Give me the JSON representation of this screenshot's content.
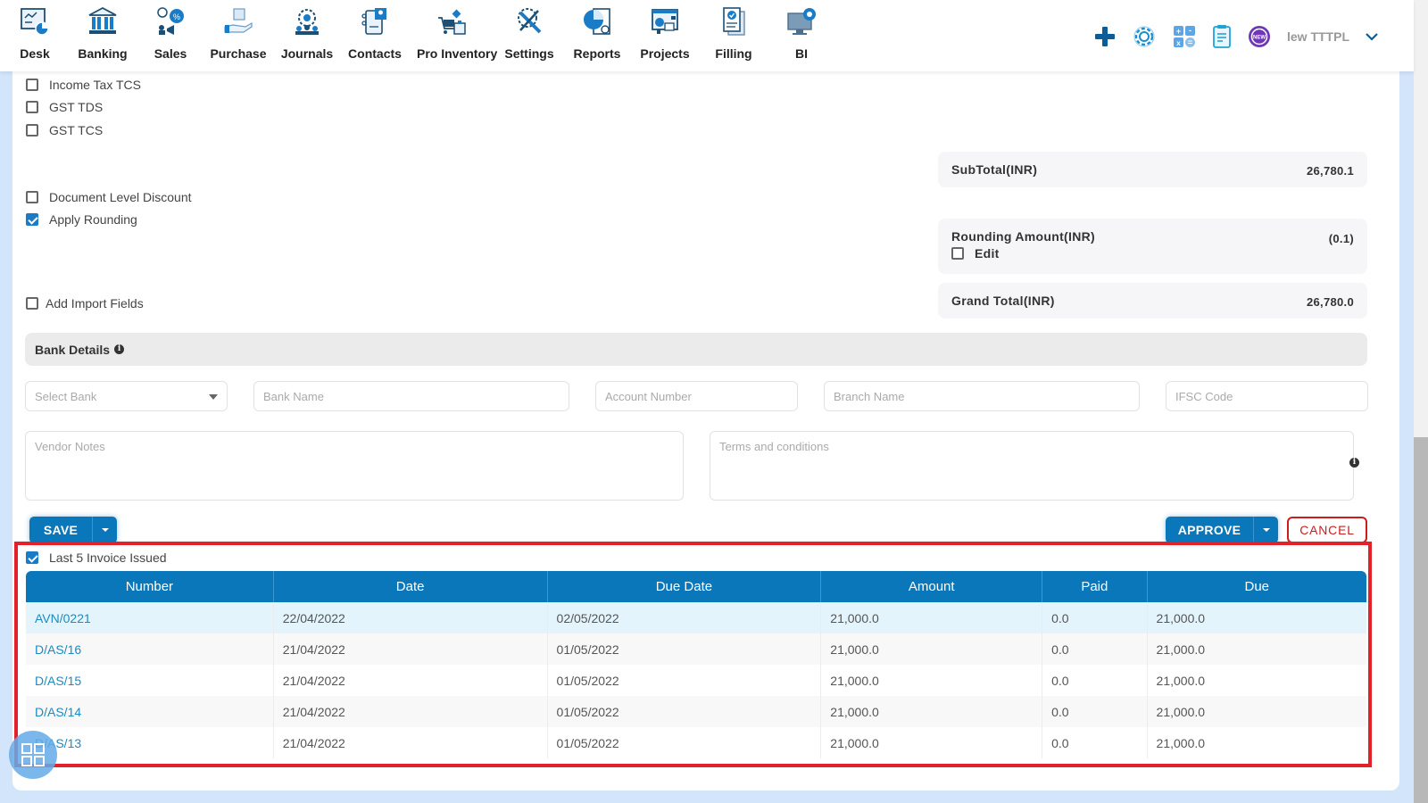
{
  "nav": {
    "items": [
      {
        "label": "Desk",
        "icon": "desk-icon"
      },
      {
        "label": "Banking",
        "icon": "bank-icon"
      },
      {
        "label": "Sales",
        "icon": "sales-icon"
      },
      {
        "label": "Purchase",
        "icon": "purchase-icon"
      },
      {
        "label": "Journals",
        "icon": "journals-icon"
      },
      {
        "label": "Contacts",
        "icon": "contacts-icon"
      },
      {
        "label": "Pro Inventory",
        "icon": "inventory-icon"
      },
      {
        "label": "Settings",
        "icon": "settings-tools-icon"
      },
      {
        "label": "Reports",
        "icon": "reports-icon"
      },
      {
        "label": "Projects",
        "icon": "projects-icon"
      },
      {
        "label": "Filling",
        "icon": "filling-icon"
      },
      {
        "label": "BI",
        "icon": "bi-icon"
      }
    ],
    "org_name": "lew TTTPL",
    "new_badge": "NEW"
  },
  "options": {
    "income_tax_tcs": {
      "label": "Income Tax TCS",
      "checked": false
    },
    "gst_tds": {
      "label": "GST TDS",
      "checked": false
    },
    "gst_tcs": {
      "label": "GST TCS",
      "checked": false
    },
    "document_level_discount": {
      "label": "Document Level Discount",
      "checked": false
    },
    "apply_rounding": {
      "label": "Apply Rounding",
      "checked": true
    },
    "add_import_fields": {
      "label": "Add Import Fields",
      "checked": false
    }
  },
  "totals": {
    "subtotal_label": "SubTotal(INR)",
    "subtotal_value": "26,780.1",
    "rounding_label": "Rounding Amount(INR)",
    "rounding_value": "(0.1)",
    "rounding_edit_label": "Edit",
    "grand_total_label": "Grand Total(INR)",
    "grand_total_value": "26,780.0"
  },
  "bank": {
    "header": "Bank Details",
    "select_bank_placeholder": "Select Bank",
    "bank_name_placeholder": "Bank Name",
    "account_number_placeholder": "Account Number",
    "branch_name_placeholder": "Branch Name",
    "ifsc_placeholder": "IFSC Code",
    "vendor_notes_placeholder": "Vendor Notes",
    "terms_placeholder": "Terms and conditions"
  },
  "actions": {
    "save": "SAVE",
    "approve": "APPROVE",
    "cancel": "CANCEL"
  },
  "last_invoices": {
    "label": "Last 5 Invoice Issued",
    "checked": true,
    "columns": [
      "Number",
      "Date",
      "Due Date",
      "Amount",
      "Paid",
      "Due"
    ],
    "rows": [
      [
        "AVN/0221",
        "22/04/2022",
        "02/05/2022",
        "21,000.0",
        "0.0",
        "21,000.0"
      ],
      [
        "D/AS/16",
        "21/04/2022",
        "01/05/2022",
        "21,000.0",
        "0.0",
        "21,000.0"
      ],
      [
        "D/AS/15",
        "21/04/2022",
        "01/05/2022",
        "21,000.0",
        "0.0",
        "21,000.0"
      ],
      [
        "D/AS/14",
        "21/04/2022",
        "01/05/2022",
        "21,000.0",
        "0.0",
        "21,000.0"
      ],
      [
        "D/AS/13",
        "21/04/2022",
        "01/05/2022",
        "21,000.0",
        "0.0",
        "21,000.0"
      ]
    ]
  },
  "colors": {
    "primary": "#0a77bb",
    "cancel": "#cc1d1d",
    "highlight": "#e3212b",
    "link": "#1d8ac0"
  }
}
